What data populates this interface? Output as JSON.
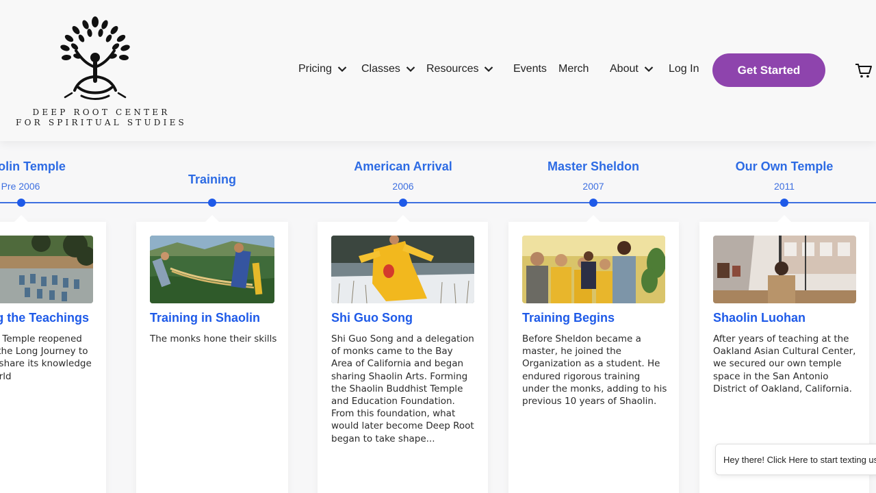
{
  "brand": {
    "line1": "DEEP ROOT CENTER",
    "line2": "FOR SPIRITUAL STUDIES"
  },
  "nav": {
    "pricing": "Pricing",
    "classes": "Classes",
    "resources": "Resources",
    "events": "Events",
    "merch": "Merch",
    "about": "About",
    "login": "Log In",
    "cta": "Get Started"
  },
  "colors": {
    "accent": "#8e44ad",
    "timeline_blue": "#1e5ae8"
  },
  "timeline": [
    {
      "title": "Shaolin Temple",
      "year": "Pre 2006",
      "card_title": "Reviving the Teachings",
      "card_text": "The Shaolin Temple reopened and began the Long Journey to once again share its knowledge with the world"
    },
    {
      "title": "Training",
      "year": "",
      "card_title": "Training in Shaolin",
      "card_text": "The monks hone their skills"
    },
    {
      "title": "American Arrival",
      "year": "2006",
      "card_title": "Shi Guo Song",
      "card_text": "Shi Guo Song and a delegation of monks came to the Bay Area of California and began sharing Shaolin Arts. Forming the Shaolin Buddhist Temple and Education Foundation. From this foundation, what would later become Deep Root began to take shape..."
    },
    {
      "title": "Master Sheldon",
      "year": "2007",
      "card_title": "Training Begins",
      "card_text": "Before Sheldon became a master, he joined the Organization as a student. He endured rigorous training under the monks, adding to his previous 10 years of Shaolin."
    },
    {
      "title": "Our Own Temple",
      "year": "2011",
      "card_title": "Shaolin Luohan",
      "card_text": "After years of teaching at the Oakland Asian Cultural Center, we secured our own temple space in the San Antonio District of Oakland, California."
    }
  ],
  "chat": {
    "label": "Hey there! Click Here to start texting us"
  },
  "icons": {
    "logo": "tree-meditation-icon",
    "cart": "cart-icon",
    "dropdown": "chevron-down-icon"
  }
}
